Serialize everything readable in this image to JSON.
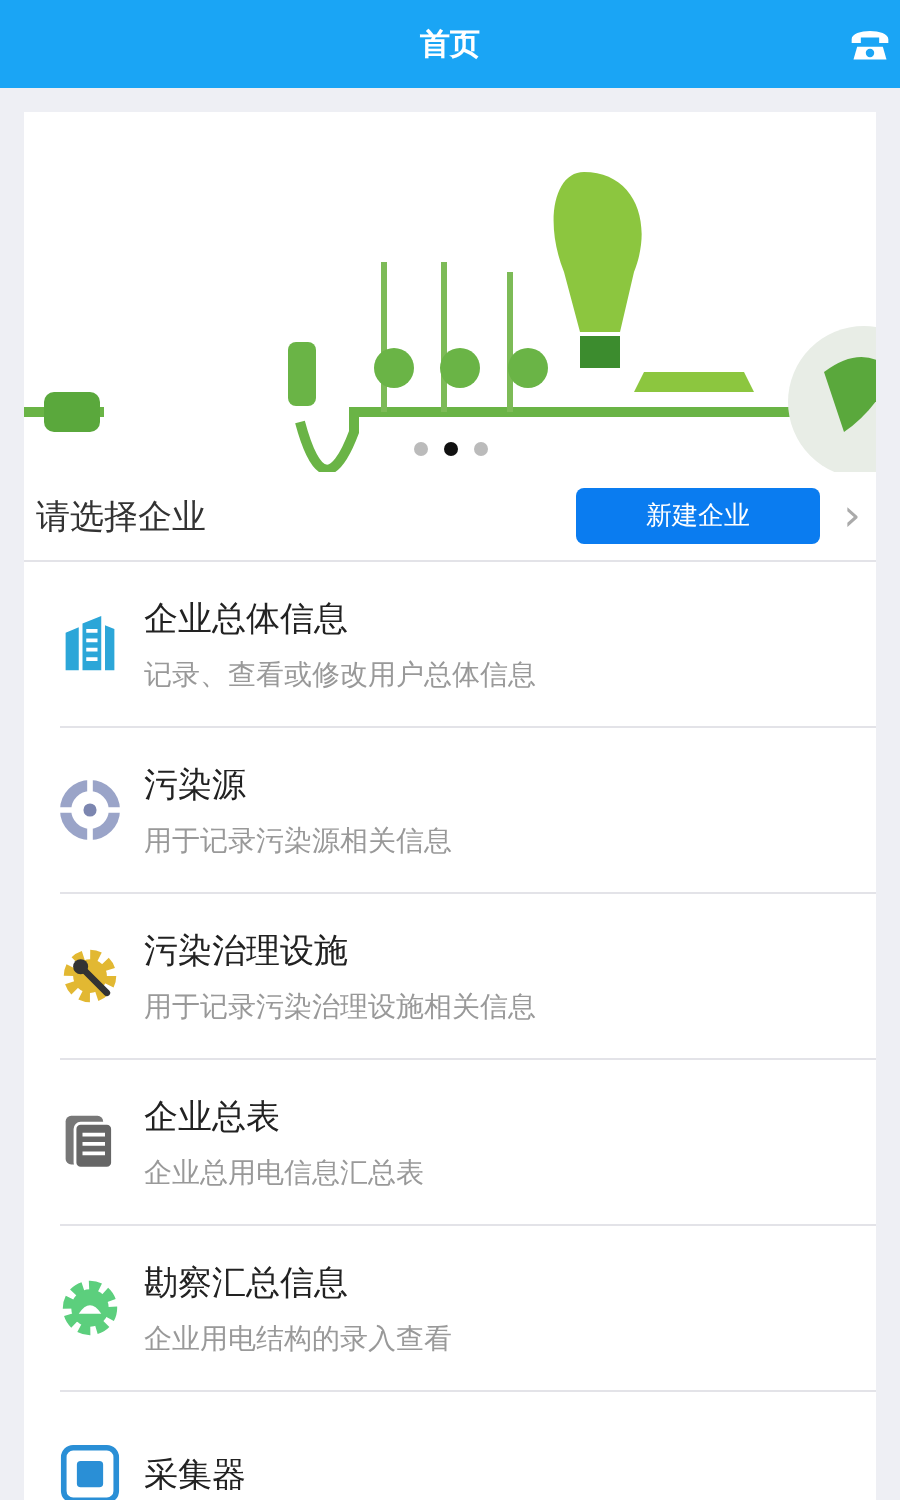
{
  "header": {
    "title": "首页"
  },
  "banner": {
    "dots": [
      {
        "selected": false
      },
      {
        "selected": true
      },
      {
        "selected": false
      }
    ]
  },
  "company_bar": {
    "label": "请选择企业",
    "button": "新建企业",
    "chevron": "›"
  },
  "menu": [
    {
      "title": "企业总体信息",
      "subtitle": "记录、查看或修改用户总体信息"
    },
    {
      "title": "污染源",
      "subtitle": "用于记录污染源相关信息"
    },
    {
      "title": "污染治理设施",
      "subtitle": "用于记录污染治理设施相关信息"
    },
    {
      "title": "企业总表",
      "subtitle": "企业总用电信息汇总表"
    },
    {
      "title": "勘察汇总信息",
      "subtitle": "企业用电结构的录入查看"
    },
    {
      "title": "采集器"
    }
  ]
}
